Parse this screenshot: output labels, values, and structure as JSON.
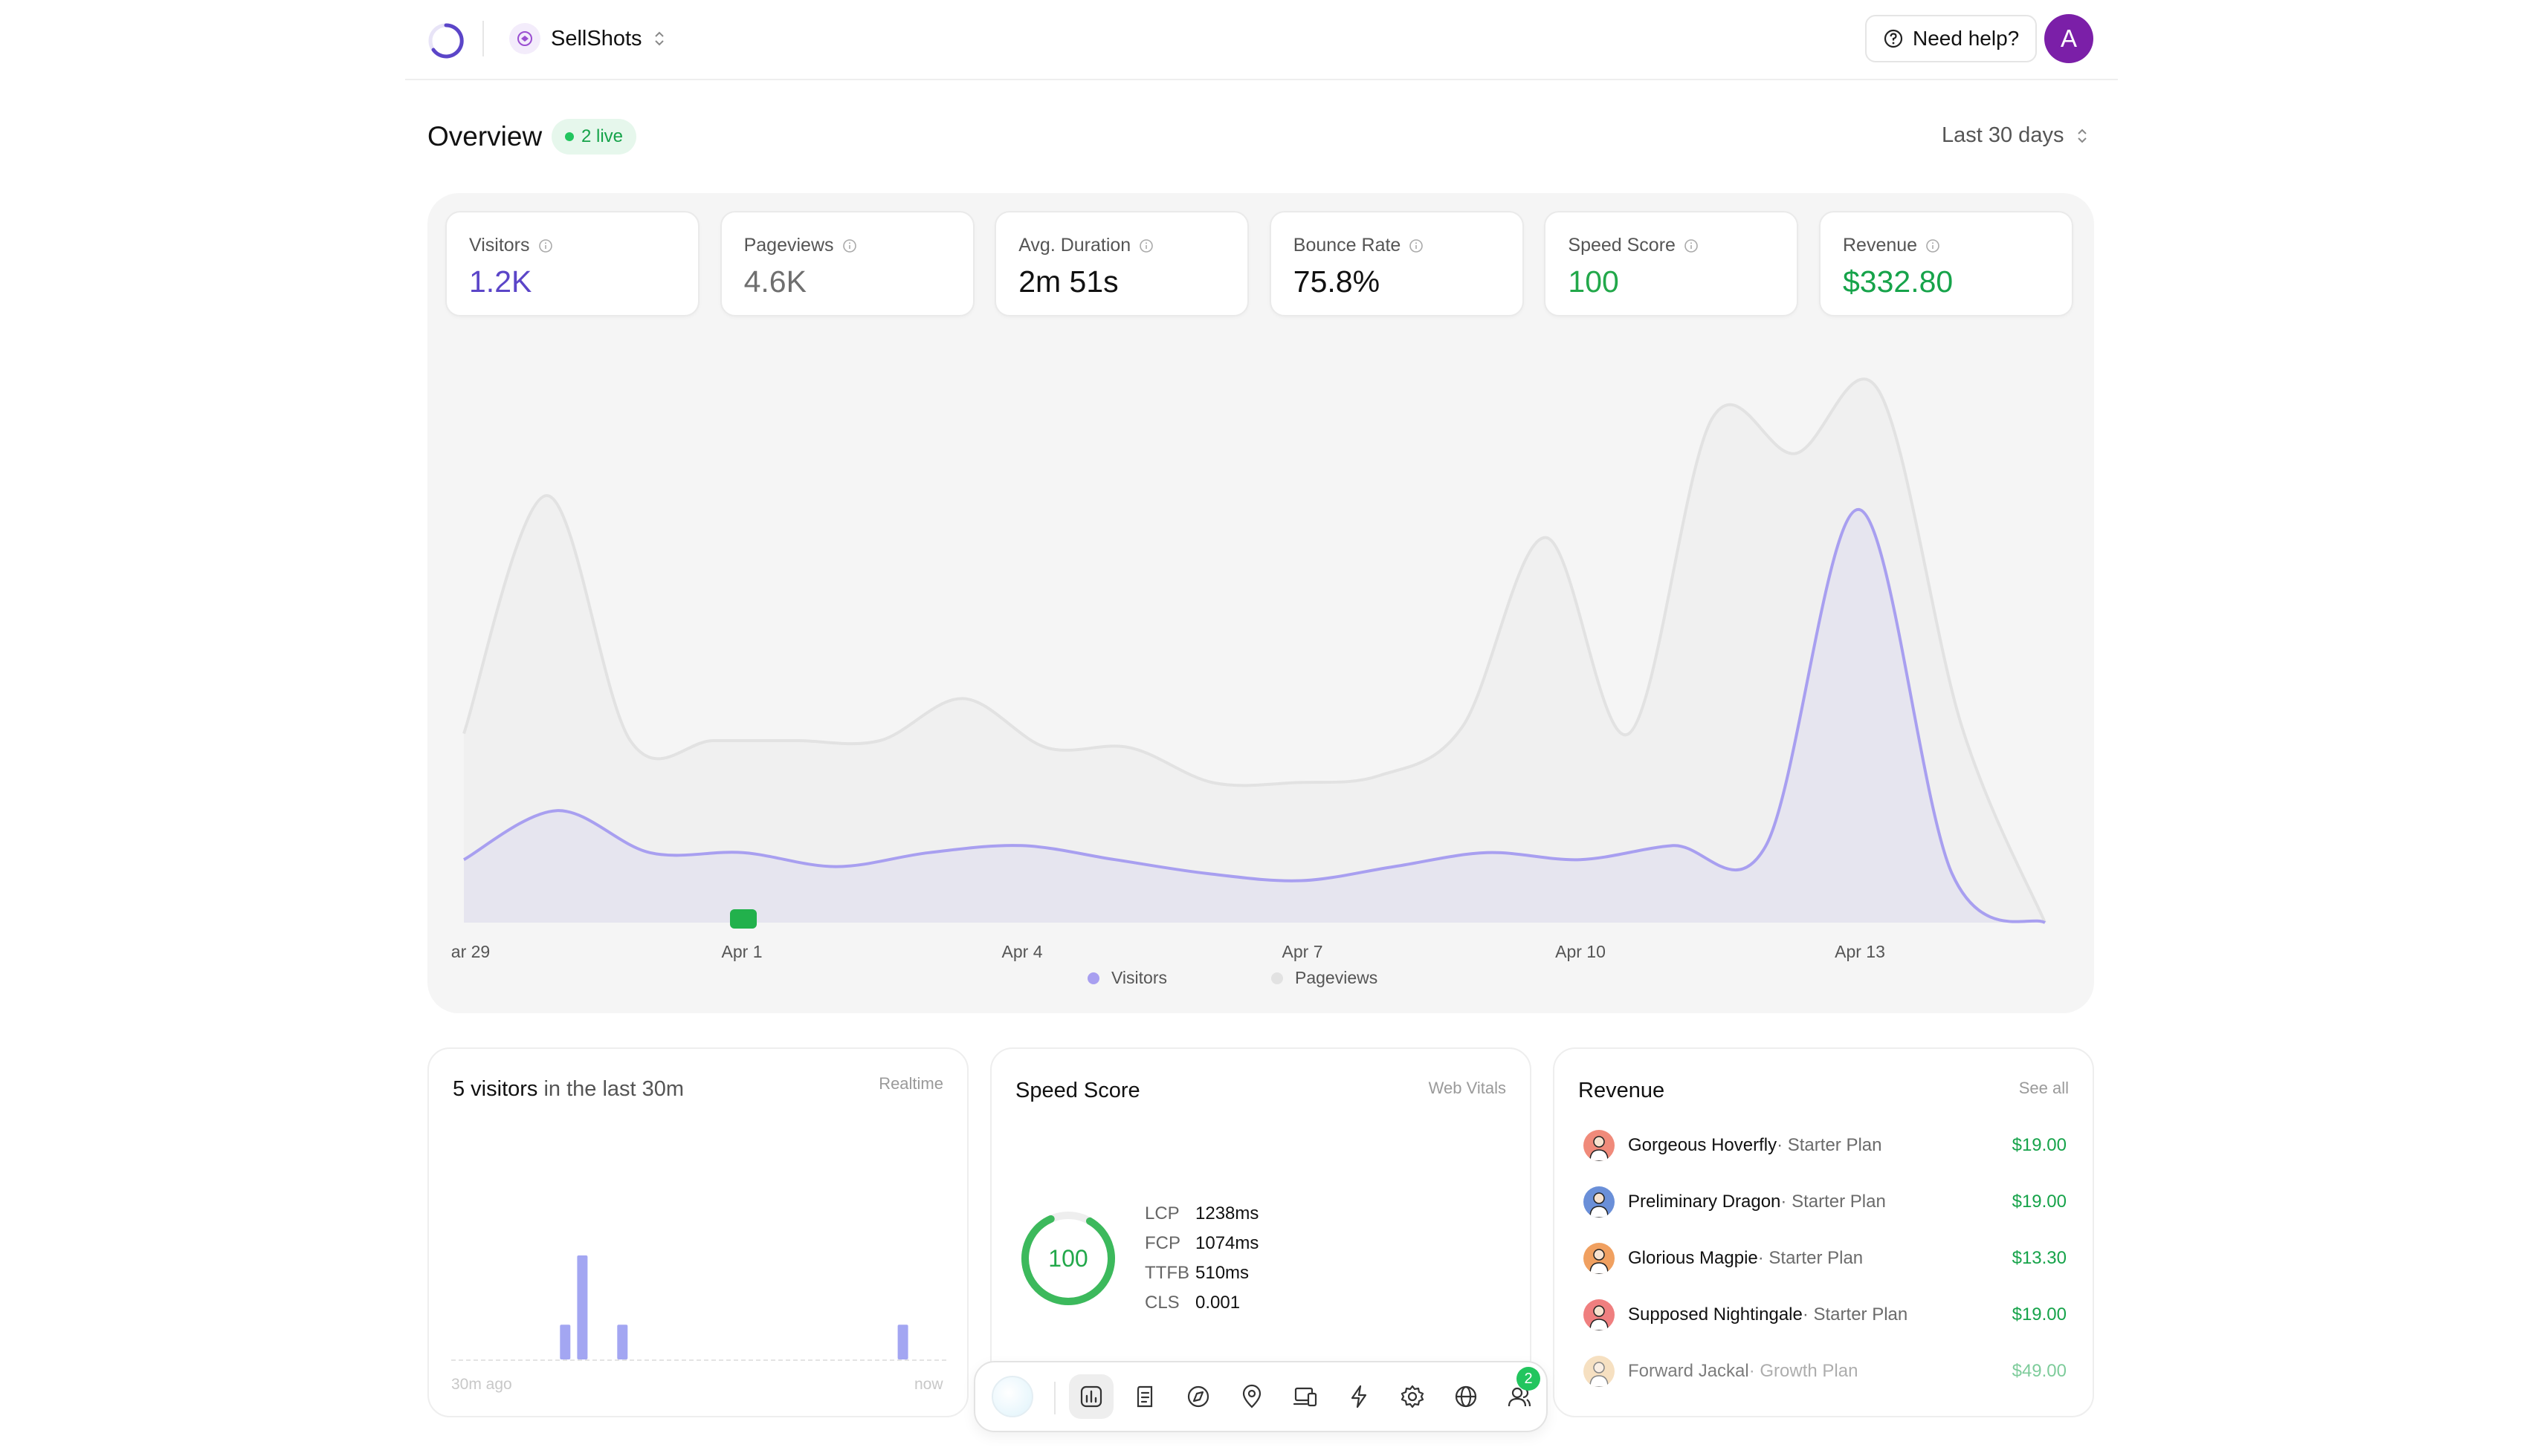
{
  "header": {
    "project_name": "SellShots",
    "help_label": "Need help?",
    "avatar_initial": "A"
  },
  "overview": {
    "title": "Overview",
    "live_badge": "2 live",
    "date_range": "Last 30 days"
  },
  "stats": [
    {
      "label": "Visitors",
      "value": "1.2K",
      "color": "#5b45c8"
    },
    {
      "label": "Pageviews",
      "value": "4.6K",
      "color": "#6f6f6f"
    },
    {
      "label": "Avg. Duration",
      "value": "2m 51s",
      "color": "#111111"
    },
    {
      "label": "Bounce Rate",
      "value": "75.8%",
      "color": "#111111"
    },
    {
      "label": "Speed Score",
      "value": "100",
      "color": "#22a84a"
    },
    {
      "label": "Revenue",
      "value": "$332.80",
      "color": "#16a34a"
    }
  ],
  "chart_data": {
    "type": "area",
    "x_tick_labels": [
      "ar 29",
      "Apr 1",
      "Apr 4",
      "Apr 7",
      "Apr 10",
      "Apr 13"
    ],
    "legend": [
      "Visitors",
      "Pageviews"
    ],
    "series": [
      {
        "name": "Pageviews",
        "color": "#e2e2e2",
        "values": [
          27,
          61,
          26,
          26,
          26,
          26,
          32,
          25,
          25,
          20,
          20,
          21,
          28,
          55,
          27,
          72,
          67,
          76,
          28,
          0
        ]
      },
      {
        "name": "Visitors",
        "color": "#a89ff0",
        "values": [
          9,
          16,
          10,
          10,
          8,
          10,
          11,
          9,
          7,
          6,
          8,
          10,
          9,
          11,
          11,
          59,
          7,
          0
        ]
      }
    ],
    "grid": false,
    "legend_position": "bottom"
  },
  "realtime": {
    "count": "5 visitors",
    "suffix": " in the last 30m",
    "link": "Realtime",
    "start_label": "30m ago",
    "end_label": "now",
    "bars": [
      0,
      0,
      0,
      0,
      0,
      0,
      0,
      0,
      0,
      0,
      0,
      0,
      0,
      0,
      0,
      0,
      0,
      0,
      0,
      1,
      0,
      0,
      3,
      0,
      0,
      0,
      0,
      0,
      0,
      1,
      0,
      0,
      0,
      0,
      0,
      0,
      0,
      0,
      0,
      0,
      0,
      0,
      0,
      0,
      0,
      0,
      0,
      0,
      0,
      0,
      0,
      0,
      0,
      0,
      0,
      0,
      0,
      0,
      0,
      0,
      0,
      0,
      0,
      0,
      0,
      0,
      0,
      0,
      0,
      0,
      0,
      0,
      0,
      0,
      0,
      0,
      0,
      0,
      1,
      0,
      0,
      0,
      0,
      0,
      0,
      0
    ]
  },
  "speed": {
    "title": "Speed Score",
    "link": "Web Vitals",
    "score": "100",
    "score_fraction": 0.85,
    "vitals": [
      {
        "key": "LCP",
        "value": "1238ms"
      },
      {
        "key": "FCP",
        "value": "1074ms"
      },
      {
        "key": "TTFB",
        "value": "510ms"
      },
      {
        "key": "CLS",
        "value": "0.001"
      }
    ]
  },
  "revenue": {
    "title": "Revenue",
    "link": "See all",
    "items": [
      {
        "name": "Gorgeous Hoverfly",
        "plan": " · Starter Plan",
        "amount": "$19.00",
        "avatar_color": "#f08a7a"
      },
      {
        "name": "Preliminary Dragon",
        "plan": " · Starter Plan",
        "amount": "$19.00",
        "avatar_color": "#6a8fd8"
      },
      {
        "name": "Glorious Magpie",
        "plan": " · Starter Plan",
        "amount": "$13.30",
        "avatar_color": "#f0a060"
      },
      {
        "name": "Supposed Nightingale",
        "plan": " · Starter Plan",
        "amount": "$19.00",
        "avatar_color": "#ef7f7f"
      },
      {
        "name": "Forward Jackal",
        "plan": " · Growth Plan",
        "amount": "$49.00",
        "avatar_color": "#f0c890"
      }
    ]
  },
  "dock": {
    "badge": "2",
    "items": [
      "analytics-icon",
      "pages-icon",
      "referrer-icon",
      "location-icon",
      "devices-icon",
      "events-icon",
      "settings-icon",
      "globe-icon",
      "users-icon"
    ]
  }
}
